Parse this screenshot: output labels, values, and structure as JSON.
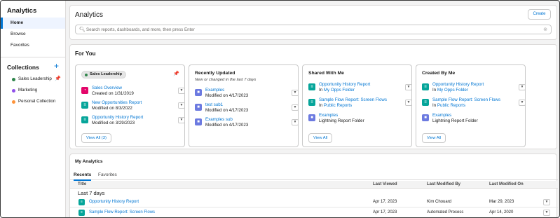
{
  "sidebar": {
    "title": "Analytics",
    "nav": [
      "Home",
      "Browse",
      "Favorites"
    ],
    "collections_title": "Collections",
    "add_symbol": "+",
    "collections": [
      {
        "label": "Sales Leadership",
        "color": "#2e844a",
        "pinned": true
      },
      {
        "label": "Marketing",
        "color": "#9050e9",
        "pinned": false
      },
      {
        "label": "Personal Collection",
        "color": "#fe9339",
        "pinned": false
      }
    ]
  },
  "header": {
    "title": "Analytics",
    "create_label": "Create",
    "search_placeholder": "Search reports, dashboards, and more, then press Enter"
  },
  "for_you": {
    "title": "For You",
    "cards": [
      {
        "pill": "Sales Leadership",
        "items": [
          {
            "icon": "dashboard-icon",
            "name": "Sales Overview",
            "meta": "Created on 1/31/2019"
          },
          {
            "icon": "report-icon",
            "name": "New Opportunities Report",
            "meta": "Modified on 8/3/2022"
          },
          {
            "icon": "report-icon",
            "name": "Opportunity History Report",
            "meta": "Modified on 3/29/2023"
          }
        ],
        "view_all": "View All (3)"
      },
      {
        "title": "Recently Updated",
        "subtitle": "New or changed in the last 7 days",
        "items": [
          {
            "icon": "folder-icon",
            "name": "Examples",
            "meta": "Modified on 4/17/2023"
          },
          {
            "icon": "folder-icon",
            "name": "test sub1",
            "meta": "Modified on 4/17/2023"
          },
          {
            "icon": "folder-icon",
            "name": "Examples sub",
            "meta": "Modified on 4/17/2023"
          }
        ]
      },
      {
        "title": "Shared With Me",
        "items": [
          {
            "icon": "report-icon",
            "name": "Opportunity History Report",
            "meta_prefix": "In",
            "meta_link": "My Opps Folder"
          },
          {
            "icon": "report-icon",
            "name": "Sample Flow Report: Screen Flows",
            "meta_prefix": "In",
            "meta_link": "Public Reports"
          },
          {
            "icon": "folder-icon",
            "name": "Examples",
            "meta": "Lightning Report Folder"
          }
        ],
        "view_all": "View All"
      },
      {
        "title": "Created By Me",
        "items": [
          {
            "icon": "report-icon",
            "name": "Opportunity History Report",
            "meta_prefix": "In",
            "meta_link": "My Opps Folder"
          },
          {
            "icon": "report-icon",
            "name": "Sample Flow Report: Screen Flows",
            "meta_prefix": "In",
            "meta_link": "Public Reports"
          },
          {
            "icon": "folder-icon",
            "name": "Examples",
            "meta": "Lightning Report Folder"
          }
        ],
        "view_all": "View All"
      }
    ]
  },
  "my_analytics": {
    "title": "My Analytics",
    "tabs": [
      "Recents",
      "Favorites"
    ],
    "columns": [
      "Title",
      "Last Viewed",
      "Last Modified By",
      "Last Modified On"
    ],
    "group_label": "Last 7 days",
    "rows": [
      {
        "title": "Opportunity History Report",
        "last_viewed": "Apr 17, 2023",
        "modified_by": "Kim Chouard",
        "modified_on": "Mar 29, 2023"
      },
      {
        "title": "Sample Flow Report: Screen Flows",
        "last_viewed": "Apr 17, 2023",
        "modified_by": "Automated Process",
        "modified_on": "Apr 14, 2020"
      }
    ]
  }
}
